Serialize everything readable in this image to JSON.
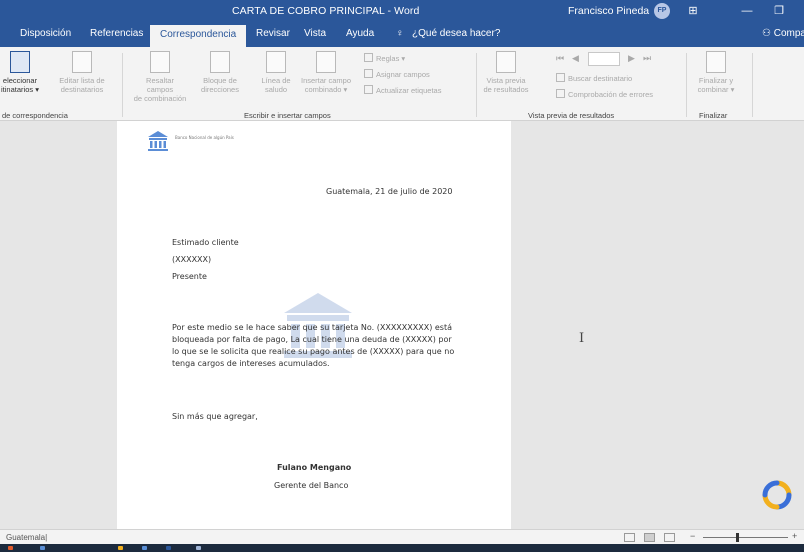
{
  "titlebar": {
    "title": "CARTA DE COBRO PRINCIPAL  -  Word",
    "user": "Francisco Pineda",
    "user_initials": "FP"
  },
  "tabs": [
    {
      "label": "Disposición"
    },
    {
      "label": "Referencias"
    },
    {
      "label": "Correspondencia"
    },
    {
      "label": "Revisar"
    },
    {
      "label": "Vista"
    },
    {
      "label": "Ayuda"
    },
    {
      "label": "¿Qué desea hacer?"
    }
  ],
  "share_label": "Compar",
  "ribbon": {
    "select_recipients": [
      "eleccionar",
      "itinatarios ▾"
    ],
    "edit_list": [
      "Editar lista de",
      "destinatarios"
    ],
    "highlight_fields": [
      "Resaltar campos",
      "de combinación"
    ],
    "address_block": [
      "Bloque de",
      "direcciones"
    ],
    "greeting_line": [
      "Línea de",
      "saludo"
    ],
    "insert_field": [
      "Insertar campo",
      "combinado ▾"
    ],
    "rules": "Reglas ▾",
    "match_fields": "Asignar campos",
    "update_labels": "Actualizar etiquetas",
    "preview": [
      "Vista previa",
      "de resultados"
    ],
    "find_recipient": "Buscar destinatario",
    "check_errors": "Comprobación de errores",
    "finish": [
      "Finalizar y",
      "combinar ▾"
    ],
    "groups": {
      "start": "de correspondencia",
      "write": "Escribir e insertar campos",
      "preview": "Vista previa de resultados",
      "finish": "Finalizar"
    }
  },
  "document": {
    "bank_logo_text": "Banco Nacional de algún País",
    "date_line": "Guatemala, 21 de julio de 2020",
    "salutation": "Estimado cliente",
    "field_name": "(XXXXXX)",
    "presente": "Presente",
    "body_lines": [
      "Por este medio se le hace saber que su tarjeta No. (XXXXXXXXX) está",
      "bloqueada por falta de pago, La cual tiene una deuda de (XXXXX) por",
      "lo que se le solicita que realice su pago antes de (XXXXX) para que no",
      "tenga cargos de intereses acumulados."
    ],
    "closing": "Sin más que agregar,",
    "signer_name": "Fulano Mengano",
    "signer_title": "Gerente del Banco"
  },
  "statusbar": {
    "left_text": "Guatemala|"
  }
}
